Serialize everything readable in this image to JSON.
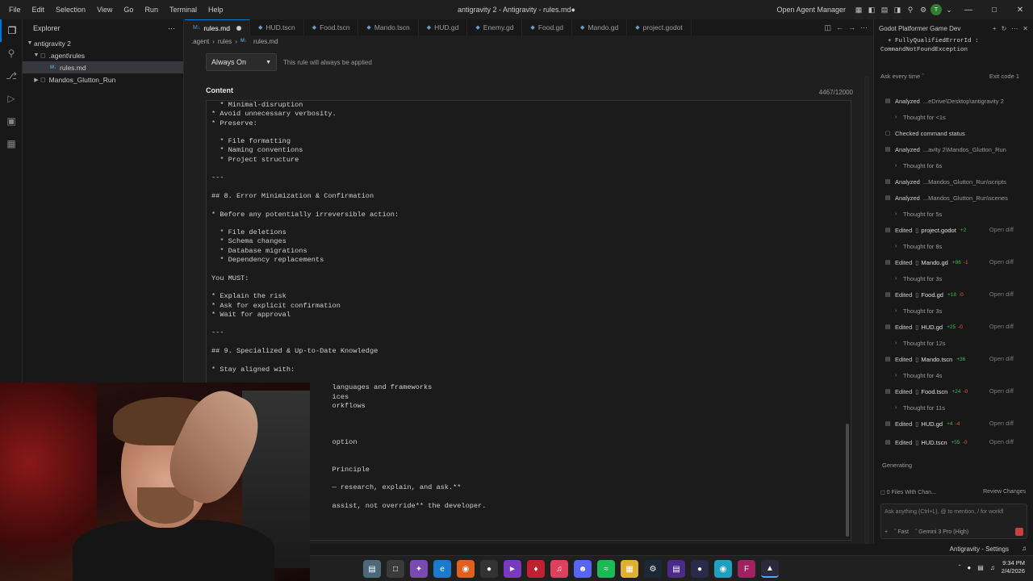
{
  "titlebar": {
    "menu": [
      "File",
      "Edit",
      "Selection",
      "View",
      "Go",
      "Run",
      "Terminal",
      "Help"
    ],
    "title": "antigravity 2 - Antigravity - rules.md●",
    "open_agent_manager": "Open Agent Manager",
    "avatar_letter": "T"
  },
  "sidebar": {
    "header": "Explorer",
    "root": "antigravity 2",
    "items": [
      {
        "label": ".agent\\rules"
      },
      {
        "label": "rules.md"
      },
      {
        "label": "Mandos_Glutton_Run"
      }
    ]
  },
  "tabs": [
    {
      "label": "rules.md",
      "active": true,
      "modified": true
    },
    {
      "label": "HUD.tscn"
    },
    {
      "label": "Food.tscn"
    },
    {
      "label": "Mando.tscn"
    },
    {
      "label": "HUD.gd"
    },
    {
      "label": "Enemy.gd"
    },
    {
      "label": "Food.gd"
    },
    {
      "label": "Mando.gd"
    },
    {
      "label": "project.godot"
    }
  ],
  "breadcrumb": [
    ".agent",
    "rules",
    "rules.md"
  ],
  "editor": {
    "select_value": "Always On",
    "select_hint": "This rule will always be applied",
    "content_label": "Content",
    "char_count": "4467/12000",
    "content_lines": [
      "  * Minimal-disruption",
      "* Avoid unnecessary verbosity.",
      "* Preserve:",
      "",
      "  * File formatting",
      "  * Naming conventions",
      "  * Project structure",
      "",
      "---",
      "",
      "## 8. Error Minimization & Confirmation",
      "",
      "* Before any potentially irreversible action:",
      "",
      "  * File deletions",
      "  * Schema changes",
      "  * Database migrations",
      "  * Dependency replacements",
      "",
      "You MUST:",
      "",
      "* Explain the risk",
      "* Ask for explicit confirmation",
      "* Wait for approval",
      "",
      "---",
      "",
      "## 9. Specialized & Up-to-Date Knowledge",
      "",
      "* Stay aligned with:",
      "",
      "                             languages and frameworks",
      "                             ices",
      "                             orkflows",
      "",
      "",
      "",
      "                             option",
      "",
      "",
      "                             Principle",
      "",
      "                             — research, explain, and ask.**",
      "",
      "                             assist, not override** the developer."
    ]
  },
  "agent": {
    "title": "Godot Platformer Game Dev",
    "terminal_lines": [
      "  + FullyQualifiedErrorId :",
      "CommandNotFoundException"
    ],
    "ask_every_time": "Ask every time",
    "exit_code": "Exit code 1",
    "steps": [
      {
        "kind": "analyzed",
        "label": "Analyzed",
        "path": "...eDrive\\Desktop\\antigravity 2"
      },
      {
        "kind": "thought",
        "label": "Thought for <1s"
      },
      {
        "kind": "status",
        "label": "Checked command status"
      },
      {
        "kind": "analyzed",
        "label": "Analyzed",
        "path": "...avity 2\\Mandos_Glutton_Run"
      },
      {
        "kind": "thought",
        "label": "Thought for 6s"
      },
      {
        "kind": "analyzed",
        "label": "Analyzed",
        "path": "...Mandos_Glutton_Run\\scripts"
      },
      {
        "kind": "analyzed",
        "label": "Analyzed",
        "path": "...Mandos_Glutton_Run\\scenes"
      },
      {
        "kind": "thought",
        "label": "Thought for 5s"
      },
      {
        "kind": "edited",
        "label": "Edited",
        "file": "project.godot",
        "add": "+2",
        "del": "",
        "diff": "Open diff"
      },
      {
        "kind": "thought",
        "label": "Thought for 8s"
      },
      {
        "kind": "edited",
        "label": "Edited",
        "file": "Mando.gd",
        "add": "+86",
        "del": "-1",
        "diff": "Open diff"
      },
      {
        "kind": "thought",
        "label": "Thought for 3s"
      },
      {
        "kind": "edited",
        "label": "Edited",
        "file": "Food.gd",
        "add": "+18",
        "del": "-0",
        "diff": "Open diff"
      },
      {
        "kind": "thought",
        "label": "Thought for 3s"
      },
      {
        "kind": "edited",
        "label": "Edited",
        "file": "HUD.gd",
        "add": "+25",
        "del": "-0",
        "diff": "Open diff"
      },
      {
        "kind": "thought",
        "label": "Thought for 12s"
      },
      {
        "kind": "edited",
        "label": "Edited",
        "file": "Mando.tscn",
        "add": "+36",
        "del": "",
        "diff": "Open diff"
      },
      {
        "kind": "thought",
        "label": "Thought for 4s"
      },
      {
        "kind": "edited",
        "label": "Edited",
        "file": "Food.tscn",
        "add": "+24",
        "del": "-0",
        "diff": "Open diff"
      },
      {
        "kind": "thought",
        "label": "Thought for 11s"
      },
      {
        "kind": "edited",
        "label": "Edited",
        "file": "HUD.gd",
        "add": "+4",
        "del": "-4",
        "diff": "Open diff"
      },
      {
        "kind": "edited",
        "label": "Edited",
        "file": "HUD.tscn",
        "add": "+55",
        "del": "-0",
        "diff": "Open diff"
      }
    ],
    "generating": "Generating",
    "files_changed": "0 Files With Chan...",
    "review_changes": "Review Changes",
    "input_placeholder": "Ask anything (Ctrl+L), @ to mention, / for workfl",
    "mode": "Fast",
    "model": "Gemini 3 Pro (High)"
  },
  "statusbar": {
    "right": "Antigravity - Settings"
  },
  "taskbar": {
    "time": "9:34 PM",
    "date": "2/4/2026"
  },
  "colors": {
    "accent": "#0078d4",
    "added": "#3fb950",
    "removed": "#f85149"
  }
}
